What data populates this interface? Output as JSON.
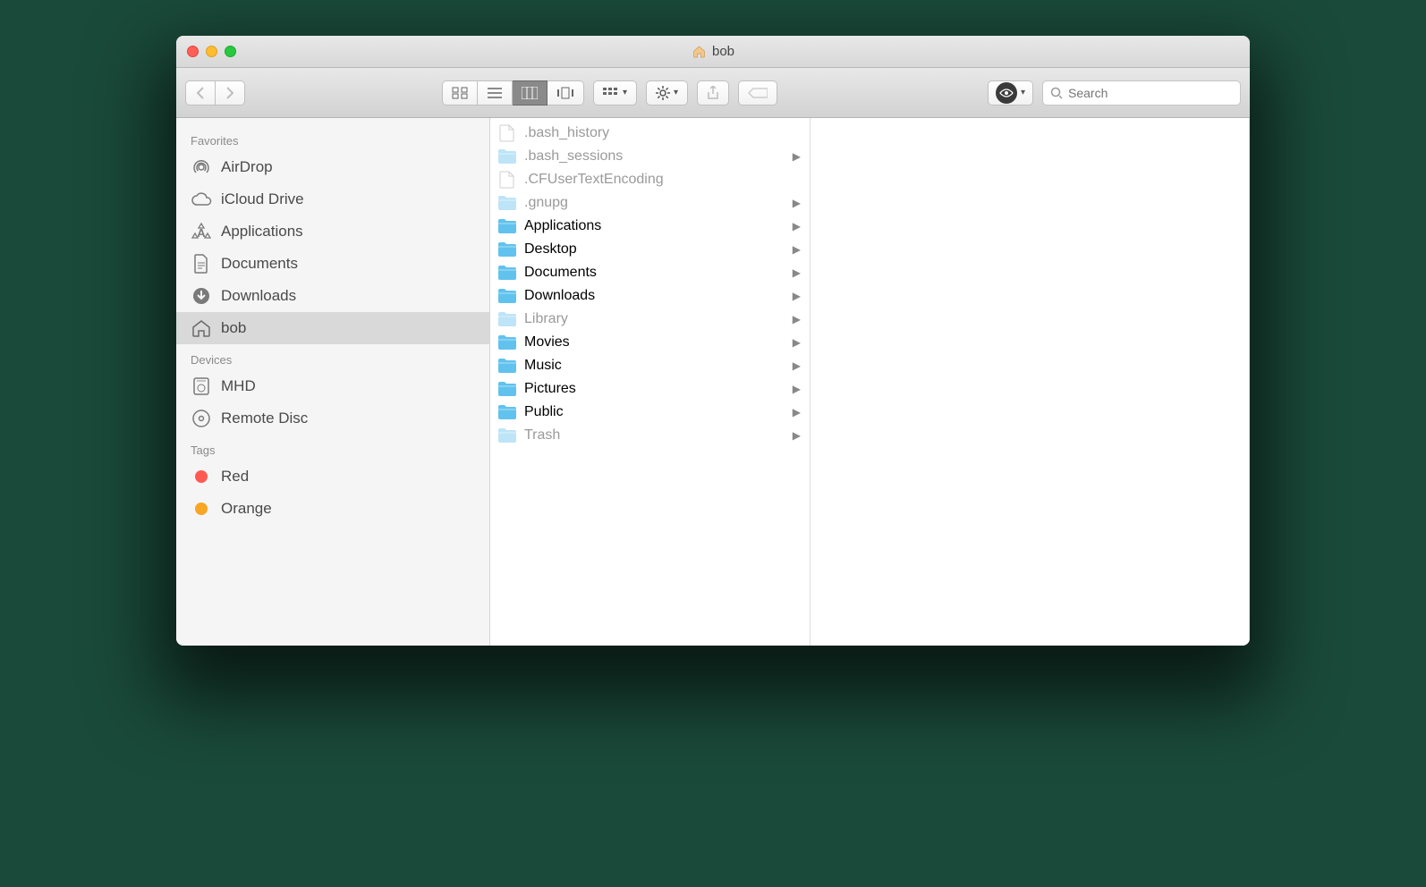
{
  "window": {
    "title": "bob"
  },
  "toolbar": {
    "search_placeholder": "Search"
  },
  "sidebar": {
    "sections": [
      {
        "heading": "Favorites",
        "items": [
          {
            "icon": "airdrop",
            "label": "AirDrop"
          },
          {
            "icon": "icloud",
            "label": "iCloud Drive"
          },
          {
            "icon": "apps",
            "label": "Applications"
          },
          {
            "icon": "doc",
            "label": "Documents"
          },
          {
            "icon": "downloads",
            "label": "Downloads"
          },
          {
            "icon": "home",
            "label": "bob",
            "selected": true
          }
        ]
      },
      {
        "heading": "Devices",
        "items": [
          {
            "icon": "disk",
            "label": "MHD"
          },
          {
            "icon": "remotedisc",
            "label": "Remote Disc"
          }
        ]
      },
      {
        "heading": "Tags",
        "items": [
          {
            "icon": "tag",
            "color": "#ff5a52",
            "label": "Red"
          },
          {
            "icon": "tag",
            "color": "#f8a623",
            "label": "Orange"
          }
        ]
      }
    ]
  },
  "columns": {
    "col1": [
      {
        "type": "file",
        "name": ".bash_history",
        "dim": true
      },
      {
        "type": "folder-light",
        "name": ".bash_sessions",
        "dim": true,
        "hasChildren": true
      },
      {
        "type": "file",
        "name": ".CFUserTextEncoding",
        "dim": true
      },
      {
        "type": "folder-light",
        "name": ".gnupg",
        "dim": true,
        "hasChildren": true
      },
      {
        "type": "folder",
        "name": "Applications",
        "hasChildren": true
      },
      {
        "type": "folder",
        "name": "Desktop",
        "hasChildren": true
      },
      {
        "type": "folder",
        "name": "Documents",
        "hasChildren": true
      },
      {
        "type": "folder",
        "name": "Downloads",
        "hasChildren": true
      },
      {
        "type": "folder-light",
        "name": "Library",
        "dim": true,
        "hasChildren": true
      },
      {
        "type": "folder",
        "name": "Movies",
        "hasChildren": true
      },
      {
        "type": "folder",
        "name": "Music",
        "hasChildren": true
      },
      {
        "type": "folder",
        "name": "Pictures",
        "hasChildren": true
      },
      {
        "type": "folder",
        "name": "Public",
        "hasChildren": true
      },
      {
        "type": "folder-light",
        "name": "Trash",
        "dim": true,
        "hasChildren": true
      }
    ]
  }
}
